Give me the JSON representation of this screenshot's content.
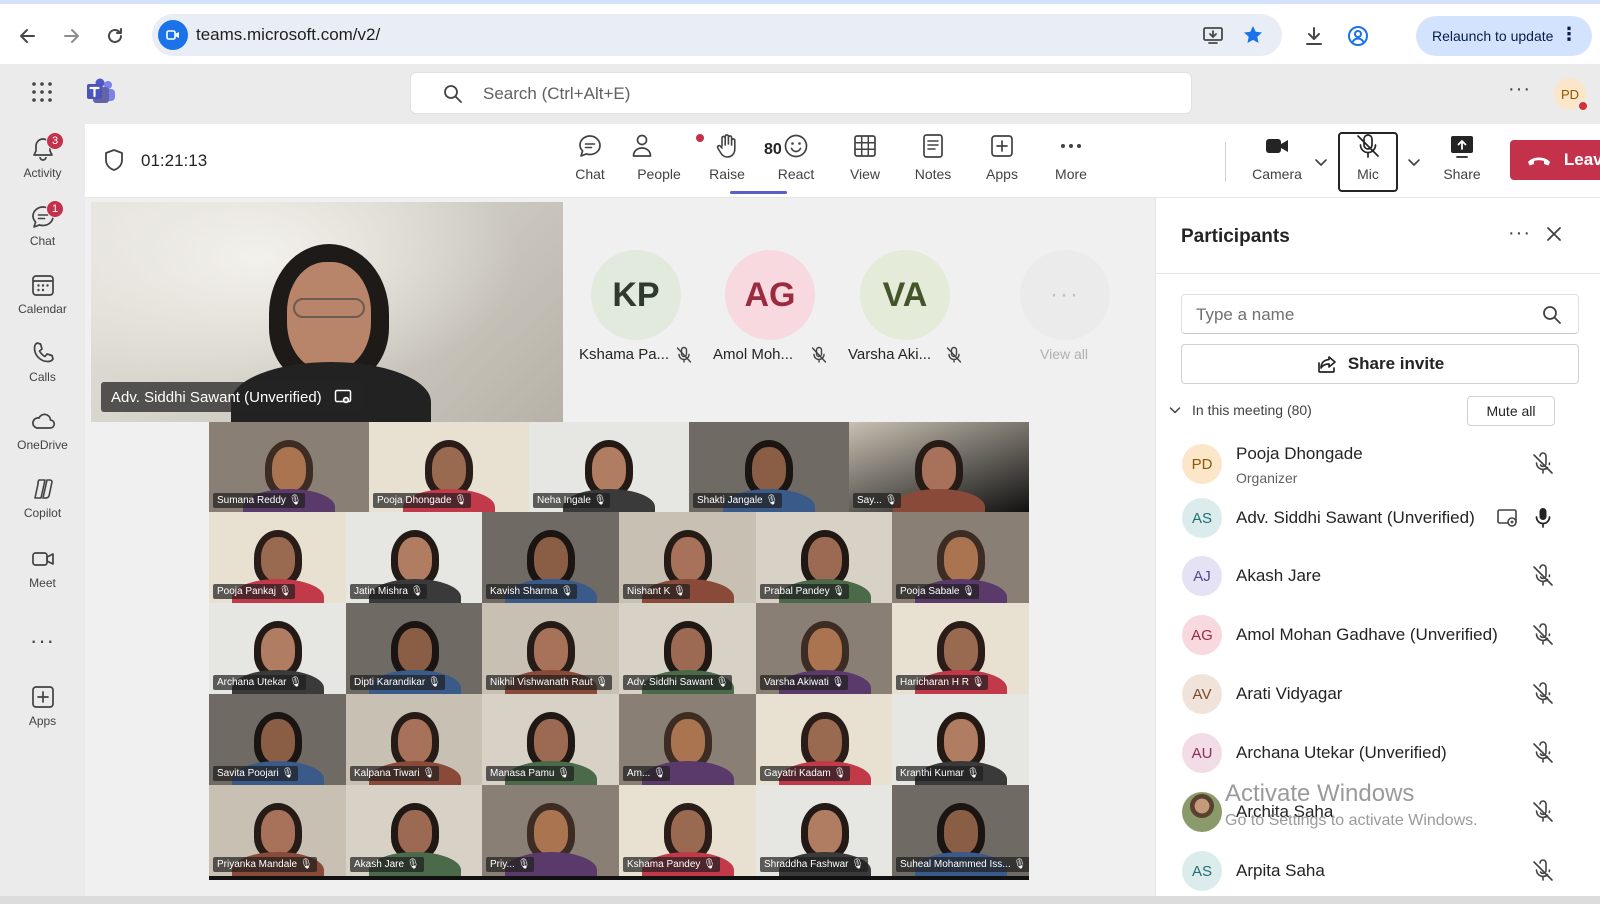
{
  "browser": {
    "url": "teams.microsoft.com/v2/",
    "relaunch_label": "Relaunch to update",
    "relaunch_dots": "⋮"
  },
  "header": {
    "search_placeholder": "Search (Ctrl+Alt+E)",
    "more_glyph": "···",
    "avatar_initials": "PD"
  },
  "rail": {
    "items": [
      {
        "label": "Activity",
        "badge": "3"
      },
      {
        "label": "Chat",
        "badge": "1"
      },
      {
        "label": "Calendar"
      },
      {
        "label": "Calls"
      },
      {
        "label": "OneDrive"
      },
      {
        "label": "Copilot"
      },
      {
        "label": "Meet"
      },
      {
        "label": "Apps"
      }
    ],
    "more_glyph": "···"
  },
  "meeting": {
    "timer": "01:21:13",
    "people_count": "80",
    "toolbar": {
      "chat": "Chat",
      "people": "People",
      "raise": "Raise",
      "react": "React",
      "view": "View",
      "notes": "Notes",
      "apps": "Apps",
      "more": "More",
      "camera": "Camera",
      "mic": "Mic",
      "share": "Share",
      "leave": "Leave"
    }
  },
  "stage": {
    "pinned_name": "Adv. Siddhi Sawant (Unverified)",
    "strip": [
      {
        "initials": "KP",
        "name": "Kshama Pa...",
        "bg": "#e2e9dd",
        "fg": "#2f3a2b"
      },
      {
        "initials": "AG",
        "name": "Amol Moh...",
        "bg": "#f7d9df",
        "fg": "#9b2c40"
      },
      {
        "initials": "VA",
        "name": "Varsha Aki...",
        "bg": "#e4ebd9",
        "fg": "#44552b"
      }
    ],
    "view_all": "View all",
    "view_all_glyph": "···",
    "gallery_row1": [
      "Sumana Reddy",
      "Pooja Dhongade",
      "Neha Ingale",
      "Shakti Jangale",
      "Say..."
    ],
    "gallery_rows": [
      [
        "Pooja Pankaj",
        "Jatin Mishra",
        "Kavish Sharma",
        "Nishant K",
        "Prabal Pandey",
        "Pooja Sabale"
      ],
      [
        "Archana Utekar",
        "Dipti Karandikar",
        "Nikhil Vishwanath Raut",
        "Adv. Siddhi Sawant",
        "Varsha Akiwati",
        "Haricharan H R"
      ],
      [
        "Savita Poojari",
        "Kalpana Tiwari",
        "Manasa Pamu",
        "Am...",
        "Gayatri Kadam",
        "Kranthi Kumar"
      ],
      [
        "Priyanka Mandale",
        "Akash Jare",
        "Priy...",
        "Kshama Pandey",
        "Shraddha Fashwar",
        "Suheal Mohammed Iss..."
      ]
    ]
  },
  "participants": {
    "title": "Participants",
    "more_glyph": "···",
    "search_placeholder": "Type a name",
    "share_invite": "Share invite",
    "section_label": "In this meeting (80)",
    "mute_all": "Mute all",
    "list": [
      {
        "initials": "PD",
        "name": "Pooja Dhongade",
        "role": "Organizer",
        "bg": "#fbe6c9",
        "fg": "#8a5a00",
        "mic": "muted"
      },
      {
        "initials": "AS",
        "name": "Adv. Siddhi Sawant (Unverified)",
        "role": "",
        "bg": "#dcecec",
        "fg": "#216f6f",
        "mic": "on",
        "sharing": true
      },
      {
        "initials": "AJ",
        "name": "Akash Jare",
        "role": "",
        "bg": "#e5e2f5",
        "fg": "#4f4a8c",
        "mic": "muted"
      },
      {
        "initials": "AG",
        "name": "Amol Mohan Gadhave (Unverified)",
        "role": "",
        "bg": "#f7d9df",
        "fg": "#9b2c40",
        "mic": "muted"
      },
      {
        "initials": "AV",
        "name": "Arati Vidyagar",
        "role": "",
        "bg": "#f0e4da",
        "fg": "#7a4a2a",
        "mic": "muted"
      },
      {
        "initials": "AU",
        "name": "Archana Utekar (Unverified)",
        "role": "",
        "bg": "#f2dde6",
        "fg": "#8c2d5a",
        "mic": "muted"
      },
      {
        "initials": "",
        "name": "Archita Saha",
        "role": "",
        "bg": "#8a9a6a",
        "fg": "#ffffff",
        "mic": "muted",
        "photo": true
      },
      {
        "initials": "AS",
        "name": "Arpita Saha",
        "role": "",
        "bg": "#dcecec",
        "fg": "#216f6f",
        "mic": "muted"
      }
    ]
  },
  "watermark": {
    "title": "Activate Windows",
    "subtitle": "Go to Settings to activate Windows."
  },
  "colors": {
    "brand": "#5b5fc7",
    "leave": "#c4314b",
    "badge": "#c4314b"
  }
}
